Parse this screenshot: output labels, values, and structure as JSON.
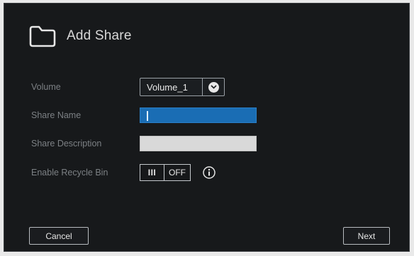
{
  "dialog": {
    "title": "Add Share",
    "icon": "folder-icon"
  },
  "form": {
    "volume": {
      "label": "Volume",
      "value": "Volume_1",
      "icon": "chevron-down-icon"
    },
    "share_name": {
      "label": "Share Name",
      "value": ""
    },
    "share_description": {
      "label": "Share Description",
      "value": ""
    },
    "recycle_bin": {
      "label": "Enable Recycle Bin",
      "handle": "III",
      "state": "OFF",
      "icon": "info-icon"
    }
  },
  "buttons": {
    "cancel_label": "Cancel",
    "next_label": "Next"
  },
  "colors": {
    "background": "#17191b",
    "accent_input": "#1a6db4",
    "text": "#d8d8d8",
    "label_text": "#7c8084"
  }
}
